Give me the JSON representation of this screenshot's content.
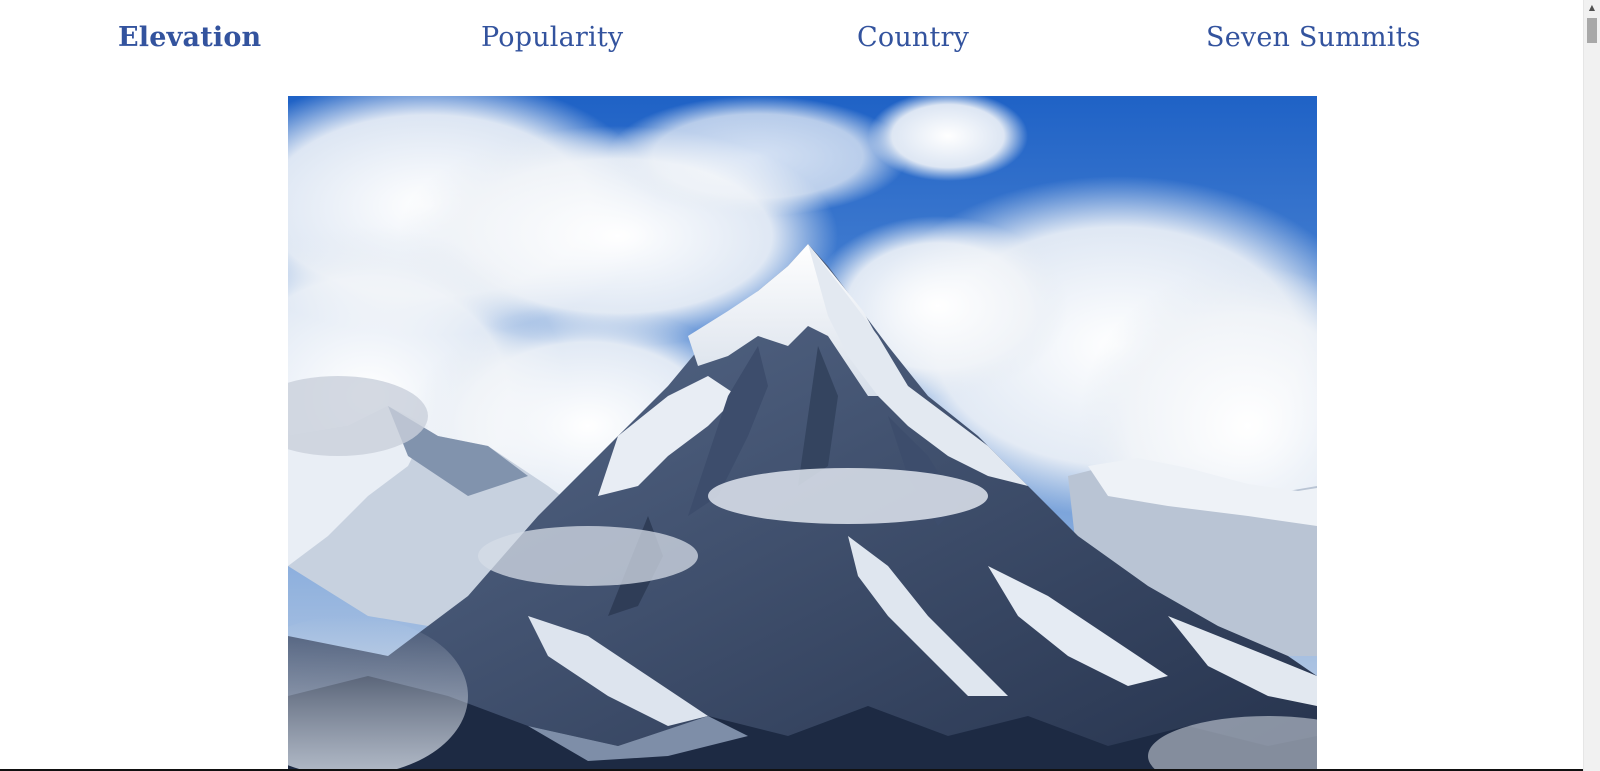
{
  "nav": {
    "tabs": [
      {
        "label": "Elevation",
        "active": true
      },
      {
        "label": "Popularity",
        "active": false
      },
      {
        "label": "Country",
        "active": false
      },
      {
        "label": "Seven Summits",
        "active": false
      }
    ]
  },
  "hero": {
    "image_subject": "snow-capped mountain peak under blue sky with clouds"
  },
  "colors": {
    "nav_text": "#33539e",
    "sky": "#2f6fcf",
    "background": "#ffffff"
  },
  "icons": {
    "scroll_up": "scroll-up-arrow-icon"
  }
}
